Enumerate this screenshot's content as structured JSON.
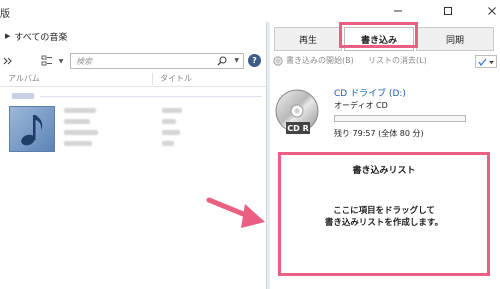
{
  "window": {
    "title_fragment": "版",
    "controls": [
      "minimize",
      "maximize",
      "close"
    ]
  },
  "library": {
    "breadcrumb": "すべての音楽",
    "search_placeholder": "検索",
    "help_label": "?",
    "columns": {
      "album": "アルバム",
      "title": "タイトル"
    },
    "icons": {
      "overflow": "chevron-double-right-icon",
      "view": "view-options-icon",
      "search": "search-icon"
    }
  },
  "burn_panel": {
    "tabs": [
      {
        "label": "再生",
        "active": false
      },
      {
        "label": "書き込み",
        "active": true
      },
      {
        "label": "同期",
        "active": false
      }
    ],
    "toolbar": {
      "start_burn": "書き込みの開始(B)",
      "clear_list": "リストの消去(L)"
    },
    "drive": {
      "name": "CD ドライブ (D:)",
      "disc_type": "オーディオ CD",
      "disc_label": "CD R",
      "remaining": "残り 79:57 (全体 80 分)",
      "used_fraction": 0.0
    },
    "burn_list": {
      "title": "書き込みリスト",
      "hint_line1": "ここに項目をドラッグして",
      "hint_line2": "書き込みリストを作成します。"
    }
  },
  "colors": {
    "highlight": "#eb5f83",
    "link": "#1a5fb4",
    "help_bg": "#3f5c86"
  }
}
